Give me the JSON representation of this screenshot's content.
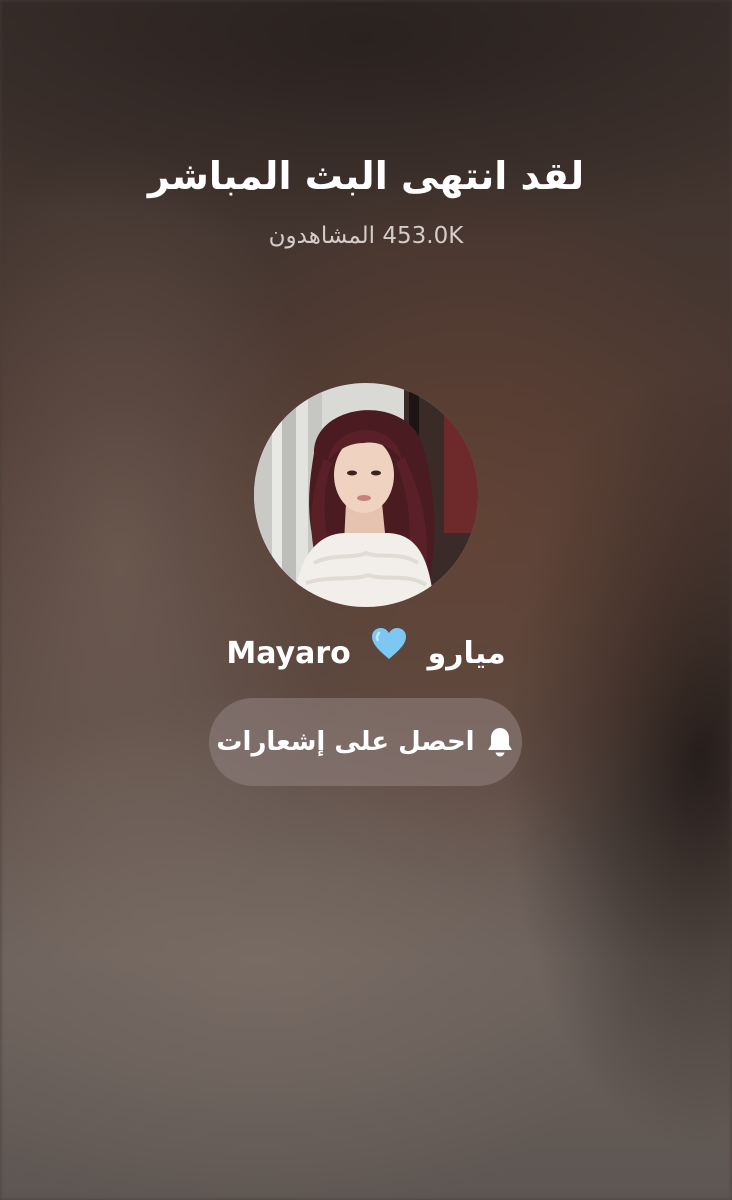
{
  "stream": {
    "ended_title": "لقد انتهى البث المباشر",
    "viewers_text": "453.0K المشاهدون"
  },
  "profile": {
    "avatar_icon": "profile-photo",
    "name_arabic": "ميارو",
    "heart_emoji": "blue-heart-icon",
    "name_latin": "Mayaro"
  },
  "notify_button": {
    "icon": "bell-icon",
    "label": "احصل على إشعارات"
  },
  "colors": {
    "heart": "#7cc8f2",
    "button_bg": "#8e7e7a"
  }
}
